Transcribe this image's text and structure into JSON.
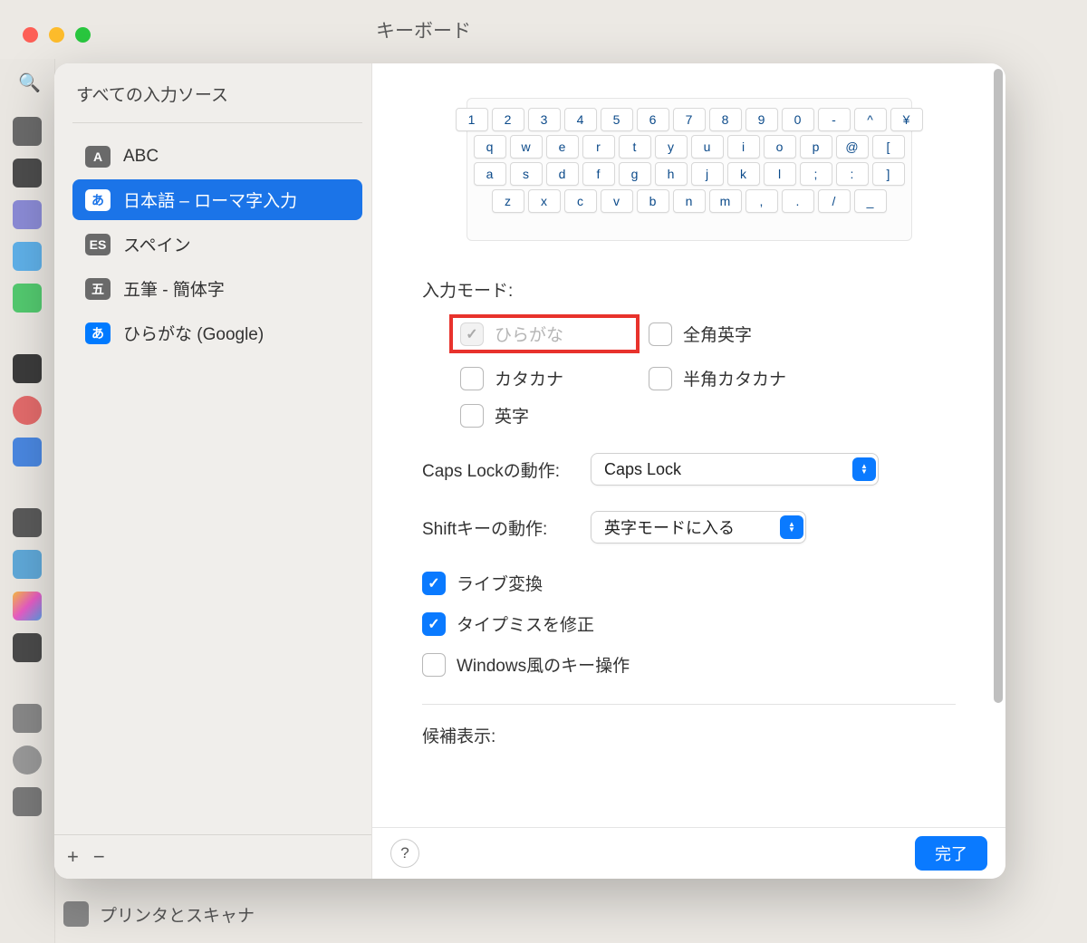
{
  "bgWindow": {
    "title": "キーボード",
    "bottomItem": "プリンタとスキャナ"
  },
  "sheet": {
    "sidebarTitle": "すべての入力ソース",
    "sources": [
      {
        "badge": "A",
        "label": "ABC",
        "selected": false,
        "badgeColor": "gray"
      },
      {
        "badge": "あ",
        "label": "日本語 – ローマ字入力",
        "selected": true,
        "badgeColor": "blue"
      },
      {
        "badge": "ES",
        "label": "スペイン",
        "selected": false,
        "badgeColor": "gray"
      },
      {
        "badge": "五",
        "label": "五筆 - 簡体字",
        "selected": false,
        "badgeColor": "gray"
      },
      {
        "badge": "あ",
        "label": "ひらがな (Google)",
        "selected": false,
        "badgeColor": "blue"
      }
    ],
    "addLabel": "+",
    "removeLabel": "−",
    "keyboard": {
      "row1": [
        "1",
        "2",
        "3",
        "4",
        "5",
        "6",
        "7",
        "8",
        "9",
        "0",
        "-",
        "^",
        "¥"
      ],
      "row2": [
        "q",
        "w",
        "e",
        "r",
        "t",
        "y",
        "u",
        "i",
        "o",
        "p",
        "@",
        "["
      ],
      "row3": [
        "a",
        "s",
        "d",
        "f",
        "g",
        "h",
        "j",
        "k",
        "l",
        ";",
        ":",
        "]"
      ],
      "row4": [
        "z",
        "x",
        "c",
        "v",
        "b",
        "n",
        "m",
        ",",
        ".",
        "/",
        "_"
      ]
    },
    "inputModeLabel": "入力モード:",
    "modes": {
      "hiragana": {
        "label": "ひらがな",
        "checked": true,
        "disabled": true
      },
      "zenkaku": {
        "label": "全角英字",
        "checked": false,
        "disabled": false
      },
      "katakana": {
        "label": "カタカナ",
        "checked": false,
        "disabled": false
      },
      "hankata": {
        "label": "半角カタカナ",
        "checked": false,
        "disabled": false
      },
      "eiji": {
        "label": "英字",
        "checked": false,
        "disabled": false
      }
    },
    "capsLock": {
      "label": "Caps Lockの動作:",
      "value": "Caps Lock"
    },
    "shiftKey": {
      "label": "Shiftキーの動作:",
      "value": "英字モードに入る"
    },
    "toggles": {
      "live": {
        "label": "ライブ変換",
        "checked": true
      },
      "typo": {
        "label": "タイプミスを修正",
        "checked": true
      },
      "windows": {
        "label": "Windows風のキー操作",
        "checked": false
      }
    },
    "candidateLabel": "候補表示:",
    "doneLabel": "完了",
    "helpLabel": "?"
  }
}
